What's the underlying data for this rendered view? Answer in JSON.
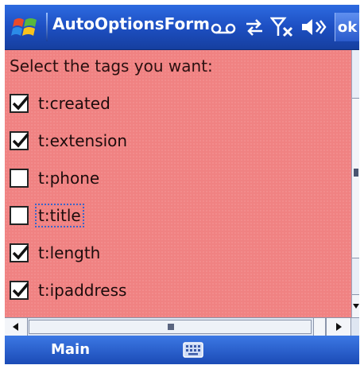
{
  "title_bar": {
    "title": "AutoOptionsForm",
    "ok_label": "ok",
    "icons": [
      "windows-flag-icon",
      "voicemail-icon",
      "sync-arrows-icon",
      "antenna-no-signal-icon",
      "speaker-icon"
    ]
  },
  "form": {
    "prompt": "Select the tags you want:",
    "options": [
      {
        "label": "t:created",
        "checked": true
      },
      {
        "label": "t:extension",
        "checked": true
      },
      {
        "label": "t:phone",
        "checked": false
      },
      {
        "label": "t:title",
        "checked": false,
        "focused": true
      },
      {
        "label": "t:length",
        "checked": true
      },
      {
        "label": "t:ipaddress",
        "checked": true
      }
    ]
  },
  "softkeys": {
    "left": "Main",
    "center_icon": "keyboard-icon"
  },
  "colors": {
    "title_bar": "#2d6be0",
    "background": "#f08282",
    "focus_outline": "#3b64c8"
  }
}
